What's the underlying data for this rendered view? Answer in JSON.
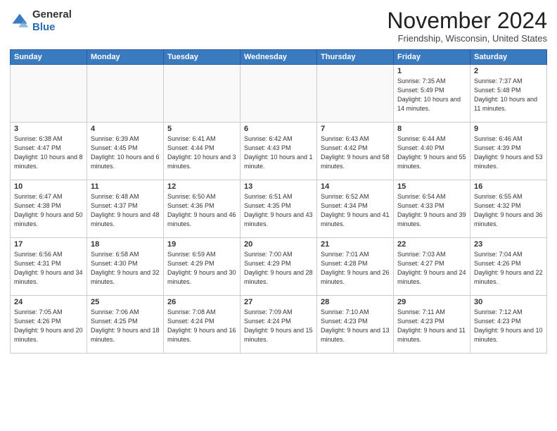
{
  "header": {
    "logo_general": "General",
    "logo_blue": "Blue",
    "month_title": "November 2024",
    "location": "Friendship, Wisconsin, United States"
  },
  "days_of_week": [
    "Sunday",
    "Monday",
    "Tuesday",
    "Wednesday",
    "Thursday",
    "Friday",
    "Saturday"
  ],
  "weeks": [
    [
      {
        "num": "",
        "info": ""
      },
      {
        "num": "",
        "info": ""
      },
      {
        "num": "",
        "info": ""
      },
      {
        "num": "",
        "info": ""
      },
      {
        "num": "",
        "info": ""
      },
      {
        "num": "1",
        "info": "Sunrise: 7:35 AM\nSunset: 5:49 PM\nDaylight: 10 hours and 14 minutes."
      },
      {
        "num": "2",
        "info": "Sunrise: 7:37 AM\nSunset: 5:48 PM\nDaylight: 10 hours and 11 minutes."
      }
    ],
    [
      {
        "num": "3",
        "info": "Sunrise: 6:38 AM\nSunset: 4:47 PM\nDaylight: 10 hours and 8 minutes."
      },
      {
        "num": "4",
        "info": "Sunrise: 6:39 AM\nSunset: 4:45 PM\nDaylight: 10 hours and 6 minutes."
      },
      {
        "num": "5",
        "info": "Sunrise: 6:41 AM\nSunset: 4:44 PM\nDaylight: 10 hours and 3 minutes."
      },
      {
        "num": "6",
        "info": "Sunrise: 6:42 AM\nSunset: 4:43 PM\nDaylight: 10 hours and 1 minute."
      },
      {
        "num": "7",
        "info": "Sunrise: 6:43 AM\nSunset: 4:42 PM\nDaylight: 9 hours and 58 minutes."
      },
      {
        "num": "8",
        "info": "Sunrise: 6:44 AM\nSunset: 4:40 PM\nDaylight: 9 hours and 55 minutes."
      },
      {
        "num": "9",
        "info": "Sunrise: 6:46 AM\nSunset: 4:39 PM\nDaylight: 9 hours and 53 minutes."
      }
    ],
    [
      {
        "num": "10",
        "info": "Sunrise: 6:47 AM\nSunset: 4:38 PM\nDaylight: 9 hours and 50 minutes."
      },
      {
        "num": "11",
        "info": "Sunrise: 6:48 AM\nSunset: 4:37 PM\nDaylight: 9 hours and 48 minutes."
      },
      {
        "num": "12",
        "info": "Sunrise: 6:50 AM\nSunset: 4:36 PM\nDaylight: 9 hours and 46 minutes."
      },
      {
        "num": "13",
        "info": "Sunrise: 6:51 AM\nSunset: 4:35 PM\nDaylight: 9 hours and 43 minutes."
      },
      {
        "num": "14",
        "info": "Sunrise: 6:52 AM\nSunset: 4:34 PM\nDaylight: 9 hours and 41 minutes."
      },
      {
        "num": "15",
        "info": "Sunrise: 6:54 AM\nSunset: 4:33 PM\nDaylight: 9 hours and 39 minutes."
      },
      {
        "num": "16",
        "info": "Sunrise: 6:55 AM\nSunset: 4:32 PM\nDaylight: 9 hours and 36 minutes."
      }
    ],
    [
      {
        "num": "17",
        "info": "Sunrise: 6:56 AM\nSunset: 4:31 PM\nDaylight: 9 hours and 34 minutes."
      },
      {
        "num": "18",
        "info": "Sunrise: 6:58 AM\nSunset: 4:30 PM\nDaylight: 9 hours and 32 minutes."
      },
      {
        "num": "19",
        "info": "Sunrise: 6:59 AM\nSunset: 4:29 PM\nDaylight: 9 hours and 30 minutes."
      },
      {
        "num": "20",
        "info": "Sunrise: 7:00 AM\nSunset: 4:29 PM\nDaylight: 9 hours and 28 minutes."
      },
      {
        "num": "21",
        "info": "Sunrise: 7:01 AM\nSunset: 4:28 PM\nDaylight: 9 hours and 26 minutes."
      },
      {
        "num": "22",
        "info": "Sunrise: 7:03 AM\nSunset: 4:27 PM\nDaylight: 9 hours and 24 minutes."
      },
      {
        "num": "23",
        "info": "Sunrise: 7:04 AM\nSunset: 4:26 PM\nDaylight: 9 hours and 22 minutes."
      }
    ],
    [
      {
        "num": "24",
        "info": "Sunrise: 7:05 AM\nSunset: 4:26 PM\nDaylight: 9 hours and 20 minutes."
      },
      {
        "num": "25",
        "info": "Sunrise: 7:06 AM\nSunset: 4:25 PM\nDaylight: 9 hours and 18 minutes."
      },
      {
        "num": "26",
        "info": "Sunrise: 7:08 AM\nSunset: 4:24 PM\nDaylight: 9 hours and 16 minutes."
      },
      {
        "num": "27",
        "info": "Sunrise: 7:09 AM\nSunset: 4:24 PM\nDaylight: 9 hours and 15 minutes."
      },
      {
        "num": "28",
        "info": "Sunrise: 7:10 AM\nSunset: 4:23 PM\nDaylight: 9 hours and 13 minutes."
      },
      {
        "num": "29",
        "info": "Sunrise: 7:11 AM\nSunset: 4:23 PM\nDaylight: 9 hours and 11 minutes."
      },
      {
        "num": "30",
        "info": "Sunrise: 7:12 AM\nSunset: 4:23 PM\nDaylight: 9 hours and 10 minutes."
      }
    ]
  ]
}
